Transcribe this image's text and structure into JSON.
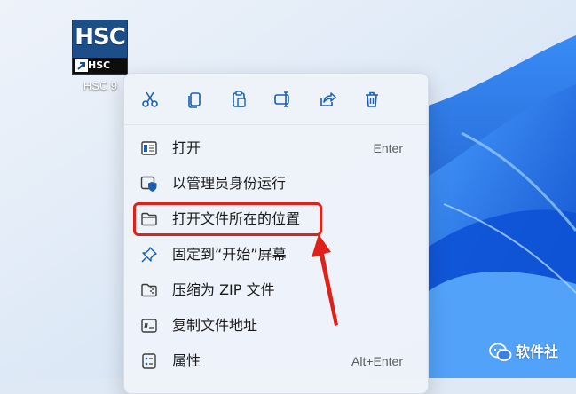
{
  "desktop": {
    "icon": {
      "logo_text": "HSC",
      "logo_small_text": "HSC",
      "label": "HSC 9"
    }
  },
  "context_menu": {
    "toolbar": [
      {
        "name": "cut",
        "icon": "scissors-icon"
      },
      {
        "name": "copy",
        "icon": "copy-icon"
      },
      {
        "name": "paste",
        "icon": "paste-icon"
      },
      {
        "name": "rename",
        "icon": "rename-icon"
      },
      {
        "name": "share",
        "icon": "share-icon"
      },
      {
        "name": "delete",
        "icon": "trash-icon"
      }
    ],
    "items": [
      {
        "label": "打开",
        "shortcut": "Enter",
        "icon": "window-icon"
      },
      {
        "label": "以管理员身份运行",
        "shortcut": "",
        "icon": "shield-icon"
      },
      {
        "label": "打开文件所在的位置",
        "shortcut": "",
        "icon": "folder-icon"
      },
      {
        "label": "固定到“开始”屏幕",
        "shortcut": "",
        "icon": "pin-icon"
      },
      {
        "label": "压缩为 ZIP 文件",
        "shortcut": "",
        "icon": "zip-folder-icon"
      },
      {
        "label": "复制文件地址",
        "shortcut": "",
        "icon": "copy-path-icon"
      },
      {
        "label": "属性",
        "shortcut": "Alt+Enter",
        "icon": "properties-icon"
      }
    ],
    "highlighted_item_index": 2
  },
  "annotation": {
    "highlight_color": "#e0211a"
  },
  "watermark": {
    "text": "软件社",
    "icon": "wechat-icon"
  },
  "colors": {
    "accent": "#1a5fb4",
    "wallpaper_blue": "#1d6fe0"
  }
}
